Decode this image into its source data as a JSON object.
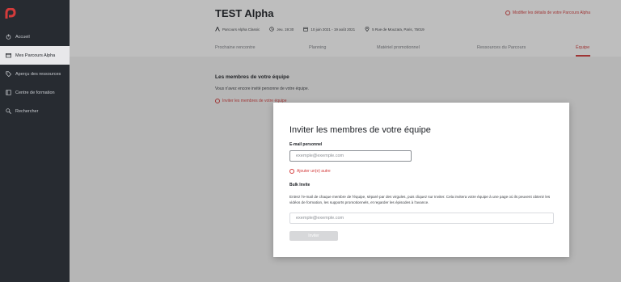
{
  "sidebar": {
    "items": [
      {
        "label": "Accueil",
        "icon": "power-icon"
      },
      {
        "label": "Mes Parcours Alpha",
        "icon": "folder-icon"
      },
      {
        "label": "Aperçu des ressources",
        "icon": "tag-icon"
      },
      {
        "label": "Centre de formation",
        "icon": "book-icon"
      },
      {
        "label": "Rechercher",
        "icon": "search-icon"
      }
    ],
    "active_index": 1
  },
  "header": {
    "title": "TEST Alpha",
    "edit_link": "Modifier les détails de votre Parcours Alpha",
    "meta": {
      "course": "Parcours Alpha Classic",
      "time": "Jeu. 19:30",
      "dates": "10 juin 2021 - 19 août 2021",
      "address": "5 Rue de Mouzaïa, Paris, 75019"
    },
    "tabs": [
      "Prochaine rencontre",
      "Planning",
      "Matériel promotionnel",
      "Ressources du Parcours",
      "Équipe"
    ],
    "active_tab": "Équipe"
  },
  "main": {
    "section_title": "Les membres de votre équipe",
    "section_desc": "Vous n'avez encore invité personne de votre équipe.",
    "invite_link": "Inviter les membres de votre équipe"
  },
  "modal": {
    "title": "Inviter les membres de votre équipe",
    "email_label": "E-mail personnel",
    "email_placeholder": "exemple@exemple.com",
    "add_link": "Ajouter un(e) autre",
    "bulk_label": "Bulk Invite",
    "bulk_desc": "Entrez l'e-mail de chaque membre de l'équipe, séparé par des virgules, puis cliquez sur Inviter. Cela invitera votre équipe à une page où ils peuvent obtenir les vidéos de formation, les supports promotionnels, et regarder les épisodes à l'avance.",
    "bulk_placeholder": "exemple@exemple.com",
    "invite_button": "Inviter"
  },
  "colors": {
    "accent": "#d33b3b",
    "sidebar": "#272b31"
  }
}
